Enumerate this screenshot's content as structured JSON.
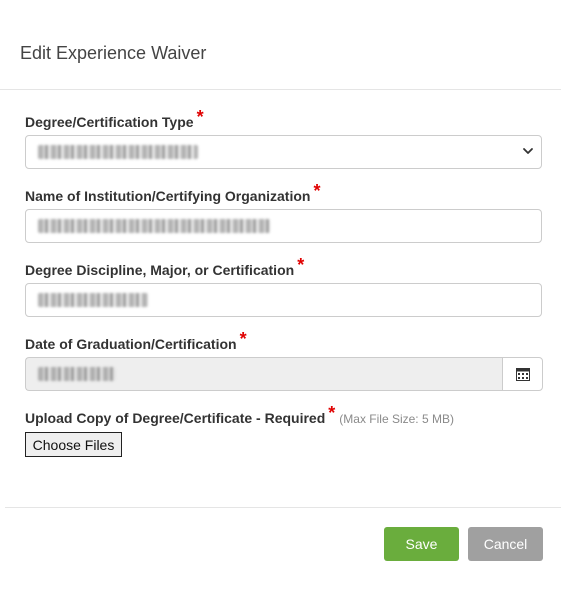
{
  "dialog": {
    "title": "Edit Experience Waiver"
  },
  "form": {
    "degree_type": {
      "label": "Degree/Certification Type",
      "required_mark": "*"
    },
    "institution": {
      "label": "Name of Institution/Certifying Organization",
      "required_mark": "*"
    },
    "discipline": {
      "label": "Degree Discipline, Major, or Certification",
      "required_mark": "*"
    },
    "graduation_date": {
      "label": "Date of Graduation/Certification",
      "required_mark": "*",
      "icon": "calendar-icon"
    },
    "upload": {
      "label": "Upload Copy of Degree/Certificate - Required",
      "required_mark": "*",
      "hint": "(Max File Size: 5 MB)",
      "button_label": "Choose Files"
    }
  },
  "footer": {
    "save_label": "Save",
    "cancel_label": "Cancel"
  },
  "colors": {
    "required": "#e00000",
    "save": "#6aad3d",
    "cancel": "#a0a0a0",
    "readonly_bg": "#eeeeee"
  }
}
